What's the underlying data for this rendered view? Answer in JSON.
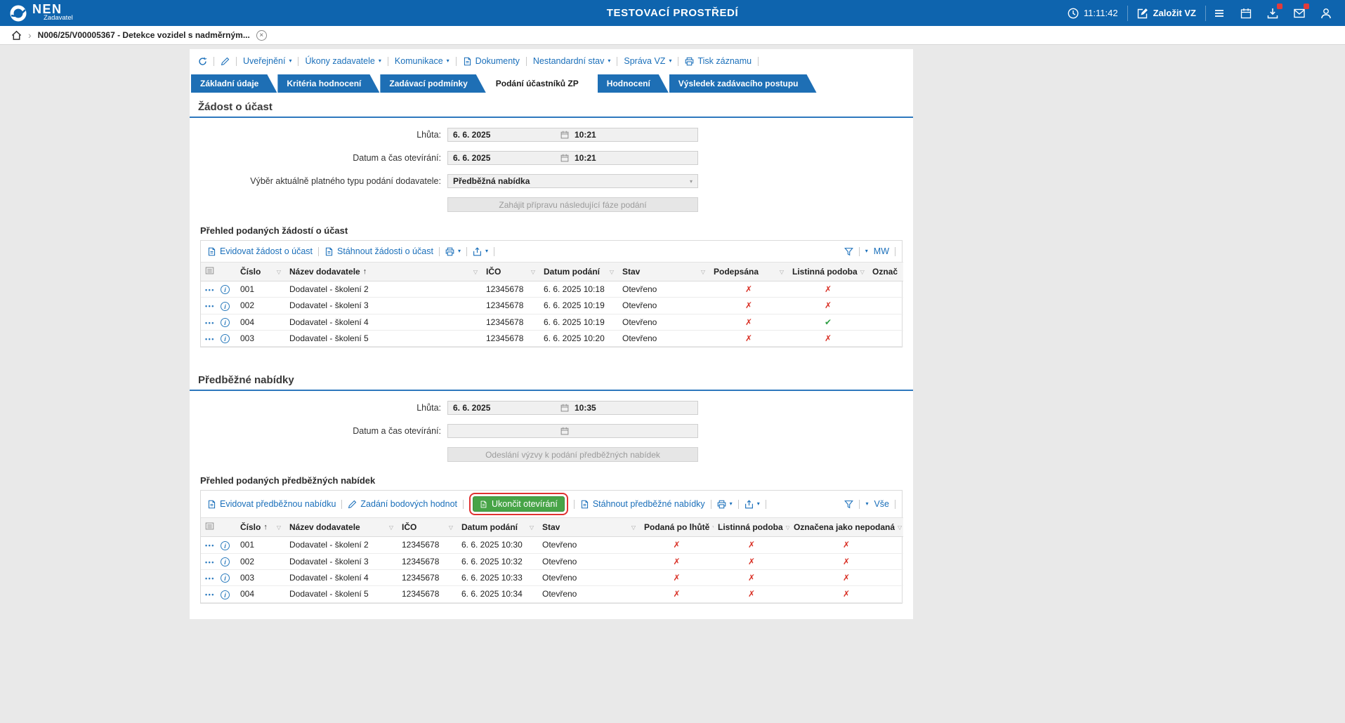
{
  "colors": {
    "topbar_blue": "#0e64ae",
    "tab_blue": "#1e6fb5",
    "link_blue": "#1a6fba",
    "green_button": "#47a447",
    "cross_red": "#d93025",
    "check_green": "#2f9e44",
    "annotation_red": "#e03131"
  },
  "icons": {
    "chevron": "▾",
    "select_chevron": "▾",
    "filter": "▽",
    "sort_asc": "↑",
    "row_menu": "•••",
    "info": "i",
    "close": "×",
    "breadcrumb_sep": "›"
  },
  "topbar": {
    "brand": "NEN",
    "brand_sub": "Zadavatel",
    "environment": "TESTOVACÍ PROSTŘEDÍ",
    "time": "11:11:42",
    "create_vz": "Založit VZ"
  },
  "breadcrumb": {
    "title": "N006/25/V00005367 - Detekce vozidel s nadměrným..."
  },
  "record_toolbar": {
    "items": [
      "Uveřejnění",
      "Úkony zadavatele",
      "Komunikace",
      "Dokumenty",
      "Nestandardní stav",
      "Správa VZ",
      "Tisk záznamu"
    ]
  },
  "tabs": [
    "Základní údaje",
    "Kritéria hodnocení",
    "Zadávací podmínky",
    "Podání účastníků ZP",
    "Hodnocení",
    "Výsledek zadávacího postupu"
  ],
  "zadost": {
    "heading": "Žádost o účast",
    "lhuta_label": "Lhůta:",
    "lhuta_date": "6. 6. 2025",
    "lhuta_time": "10:21",
    "otevirani_label": "Datum a čas otevírání:",
    "otevirani_date": "6. 6. 2025",
    "otevirani_time": "10:21",
    "typ_label": "Výběr aktuálně platného typu podání dodavatele:",
    "typ_value": "Předběžná nabídka",
    "zahajit_button": "Zahájit přípravu následující fáze podání",
    "grid_title": "Přehled podaných žádostí o účast",
    "actions": {
      "evidovat": "Evidovat žádost o účast",
      "stahnout": "Stáhnout žádosti o účast"
    },
    "view": "MW",
    "headers": [
      "Číslo",
      "Název dodavatele",
      "IČO",
      "Datum podání",
      "Stav",
      "Podepsána",
      "Listinná podoba",
      "Označ"
    ],
    "rows": [
      {
        "cislo": "001",
        "nazev": "Dodavatel - školení 2",
        "ico": "12345678",
        "datum": "6. 6. 2025 10:18",
        "stav": "Otevřeno",
        "podepsana": "✗",
        "listinna": "✗"
      },
      {
        "cislo": "002",
        "nazev": "Dodavatel - školení 3",
        "ico": "12345678",
        "datum": "6. 6. 2025 10:19",
        "stav": "Otevřeno",
        "podepsana": "✗",
        "listinna": "✗"
      },
      {
        "cislo": "004",
        "nazev": "Dodavatel - školení 4",
        "ico": "12345678",
        "datum": "6. 6. 2025 10:19",
        "stav": "Otevřeno",
        "podepsana": "✗",
        "listinna": "✔"
      },
      {
        "cislo": "003",
        "nazev": "Dodavatel - školení 5",
        "ico": "12345678",
        "datum": "6. 6. 2025 10:20",
        "stav": "Otevřeno",
        "podepsana": "✗",
        "listinna": "✗"
      }
    ]
  },
  "nabidky": {
    "heading": "Předběžné nabídky",
    "lhuta_label": "Lhůta:",
    "lhuta_date": "6. 6. 2025",
    "lhuta_time": "10:35",
    "otevirani_label": "Datum a čas otevírání:",
    "odeslani_button": "Odeslání výzvy k podání předběžných nabídek",
    "grid_title": "Přehled podaných předběžných nabídek",
    "actions": {
      "evidovat": "Evidovat předběžnou nabídku",
      "zadani": "Zadání bodových hodnot",
      "ukoncit": "Ukončit otevírání",
      "stahnout": "Stáhnout předběžné nabídky"
    },
    "view": "Vše",
    "headers": [
      "Číslo",
      "Název dodavatele",
      "IČO",
      "Datum podání",
      "Stav",
      "Podaná po lhůtě",
      "Listinná podoba",
      "Označena jako nepodaná"
    ],
    "rows": [
      {
        "cislo": "001",
        "nazev": "Dodavatel - školení 2",
        "ico": "12345678",
        "datum": "6. 6. 2025 10:30",
        "stav": "Otevřeno",
        "po_lhute": "✗",
        "listinna": "✗",
        "nepodana": "✗"
      },
      {
        "cislo": "002",
        "nazev": "Dodavatel - školení 3",
        "ico": "12345678",
        "datum": "6. 6. 2025 10:32",
        "stav": "Otevřeno",
        "po_lhute": "✗",
        "listinna": "✗",
        "nepodana": "✗"
      },
      {
        "cislo": "003",
        "nazev": "Dodavatel - školení 4",
        "ico": "12345678",
        "datum": "6. 6. 2025 10:33",
        "stav": "Otevřeno",
        "po_lhute": "✗",
        "listinna": "✗",
        "nepodana": "✗"
      },
      {
        "cislo": "004",
        "nazev": "Dodavatel - školení 5",
        "ico": "12345678",
        "datum": "6. 6. 2025 10:34",
        "stav": "Otevřeno",
        "po_lhute": "✗",
        "listinna": "✗",
        "nepodana": "✗"
      }
    ]
  }
}
